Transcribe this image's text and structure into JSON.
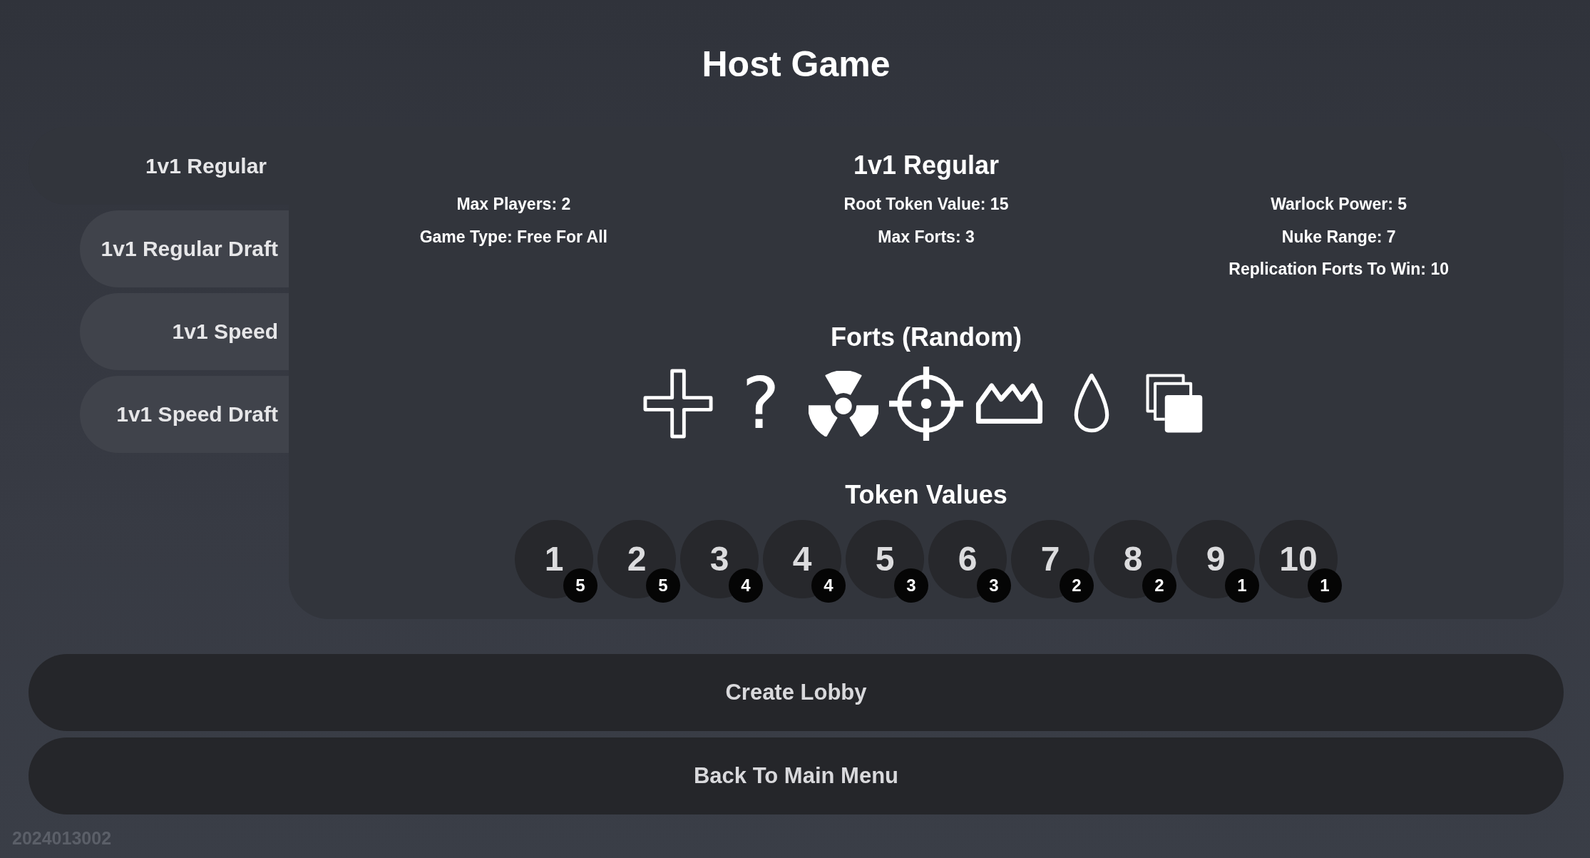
{
  "title": "Host Game",
  "modes": [
    {
      "label": "1v1 Regular",
      "selected": true
    },
    {
      "label": "1v1 Regular Draft",
      "selected": false
    },
    {
      "label": "1v1 Speed",
      "selected": false
    },
    {
      "label": "1v1 Speed Draft",
      "selected": false
    }
  ],
  "details": {
    "name": "1v1 Regular",
    "setting_columns": [
      [
        "Max Players: 2",
        "Game Type: Free For All"
      ],
      [
        "Root Token Value: 15",
        "Max Forts: 3"
      ],
      [
        "Warlock Power: 5",
        "Nuke Range: 7",
        "Replication Forts To Win: 10"
      ]
    ],
    "forts": {
      "heading": "Forts (Random)",
      "items": [
        {
          "kind": "plus"
        },
        {
          "kind": "glyph",
          "text": "?"
        },
        {
          "kind": "radiation"
        },
        {
          "kind": "crosshair"
        },
        {
          "kind": "crown"
        },
        {
          "kind": "droplet"
        },
        {
          "kind": "stack"
        }
      ]
    },
    "tokens": {
      "heading": "Token Values",
      "items": [
        {
          "value": "1",
          "count": "5"
        },
        {
          "value": "2",
          "count": "5"
        },
        {
          "value": "3",
          "count": "4"
        },
        {
          "value": "4",
          "count": "4"
        },
        {
          "value": "5",
          "count": "3"
        },
        {
          "value": "6",
          "count": "3"
        },
        {
          "value": "7",
          "count": "2"
        },
        {
          "value": "8",
          "count": "2"
        },
        {
          "value": "9",
          "count": "1"
        },
        {
          "value": "10",
          "count": "1"
        }
      ]
    }
  },
  "buttons": [
    "Create Lobby",
    "Back To Main Menu"
  ],
  "version": "2024013002"
}
